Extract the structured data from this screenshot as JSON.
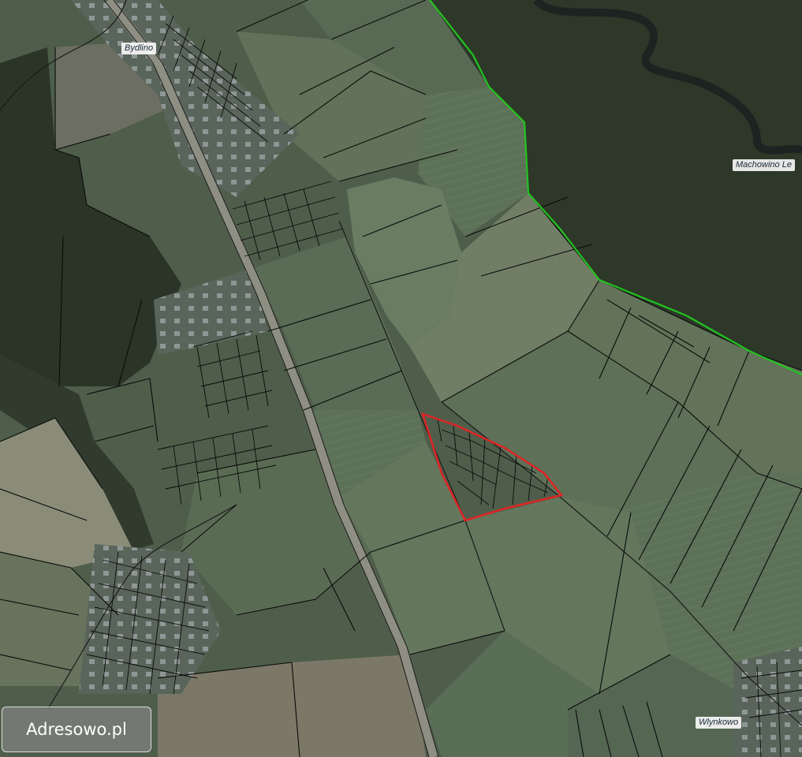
{
  "map": {
    "labels": {
      "bydlino": "Bydlino",
      "machowino": "Machowino Le",
      "wlynkowo": "Wlynkowo"
    },
    "watermark": "Adresowo.pl",
    "colors": {
      "forest": "#2f3b2c",
      "field": "#5b6e57",
      "field_light": "#6f7d66",
      "field_dark": "#4a5846",
      "road": "#9a9a8e",
      "parcel_line": "#0a0a0a",
      "boundary_green": "#22c31f",
      "highlight_red": "#e02424"
    },
    "features": {
      "highlighted_parcel": "selected plot",
      "admin_boundary": "green boundary line"
    }
  }
}
